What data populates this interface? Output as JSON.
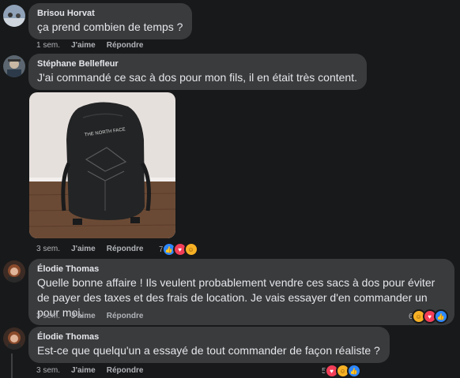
{
  "comments": [
    {
      "name": "Brisou Horvat",
      "text": "ça prend combien de temps ?",
      "time": "1 sem.",
      "like_label": "J'aime",
      "reply_label": "Répondre"
    },
    {
      "name": "Stéphane Bellefleur",
      "text": "J'ai commandé ce sac à dos pour mon fils, il en était très content.",
      "time": "3 sem.",
      "like_label": "J'aime",
      "reply_label": "Répondre",
      "reaction_count": "7",
      "reactions": [
        "like-icon",
        "love-icon",
        "care-icon"
      ],
      "image_brand": "THE NORTH FACE"
    },
    {
      "name": "Élodie Thomas",
      "text": "Quelle bonne affaire ! Ils veulent probablement vendre ces sacs à dos pour éviter de payer des taxes et des frais de location. Je vais essayer d'en commander un pour moi.",
      "time": "3 sem.",
      "like_label": "J'aime",
      "reply_label": "Répondre",
      "reaction_count": "6",
      "reactions": [
        "care-icon",
        "love-icon",
        "like-icon"
      ]
    },
    {
      "name": "Élodie Thomas",
      "text": "Est-ce que quelqu'un a essayé de tout commander de façon réaliste ?",
      "time": "3 sem.",
      "like_label": "J'aime",
      "reply_label": "Répondre",
      "reaction_count": "5",
      "reactions": [
        "love-icon",
        "care-icon",
        "like-icon"
      ]
    }
  ],
  "colors": {
    "background": "#18191a",
    "bubble": "#3a3b3c",
    "like": "#2d88ff",
    "love": "#f33e58",
    "care": "#f7b125"
  }
}
